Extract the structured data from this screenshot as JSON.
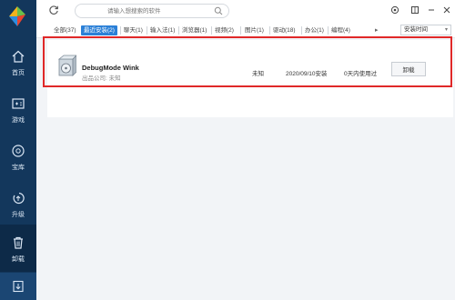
{
  "sidebar": {
    "items": [
      {
        "label": "首页",
        "icon": "home-icon"
      },
      {
        "label": "游戏",
        "icon": "gamepad-icon"
      },
      {
        "label": "宝库",
        "icon": "treasure-icon"
      },
      {
        "label": "升级",
        "icon": "upgrade-icon"
      },
      {
        "label": "卸载",
        "icon": "trash-icon"
      }
    ],
    "bottom_icon": "download-icon",
    "active_color": "#0d2a48",
    "bg_color": "#13375c"
  },
  "search": {
    "placeholder": "请输入想搜索的软件"
  },
  "tabs": [
    {
      "label": "全部(37)"
    },
    {
      "label": "最近安装(2)"
    },
    {
      "label": "聊天(1)"
    },
    {
      "label": "输入法(1)"
    },
    {
      "label": "浏览器(1)"
    },
    {
      "label": "视频(2)"
    },
    {
      "label": "图片(1)"
    },
    {
      "label": "驱动(18)"
    },
    {
      "label": "办公(1)"
    },
    {
      "label": "编程(4)"
    }
  ],
  "sort": {
    "label": "安装时间"
  },
  "apps": [
    {
      "name": "DebugMode Wink",
      "publisher": "出品公司: 未知",
      "size": "未知",
      "install_date": "2020/09/10安装",
      "usage": "0天内使用过",
      "action": "卸载"
    }
  ],
  "colors": {
    "accent": "#2b80d7",
    "highlight": "#e02828"
  }
}
